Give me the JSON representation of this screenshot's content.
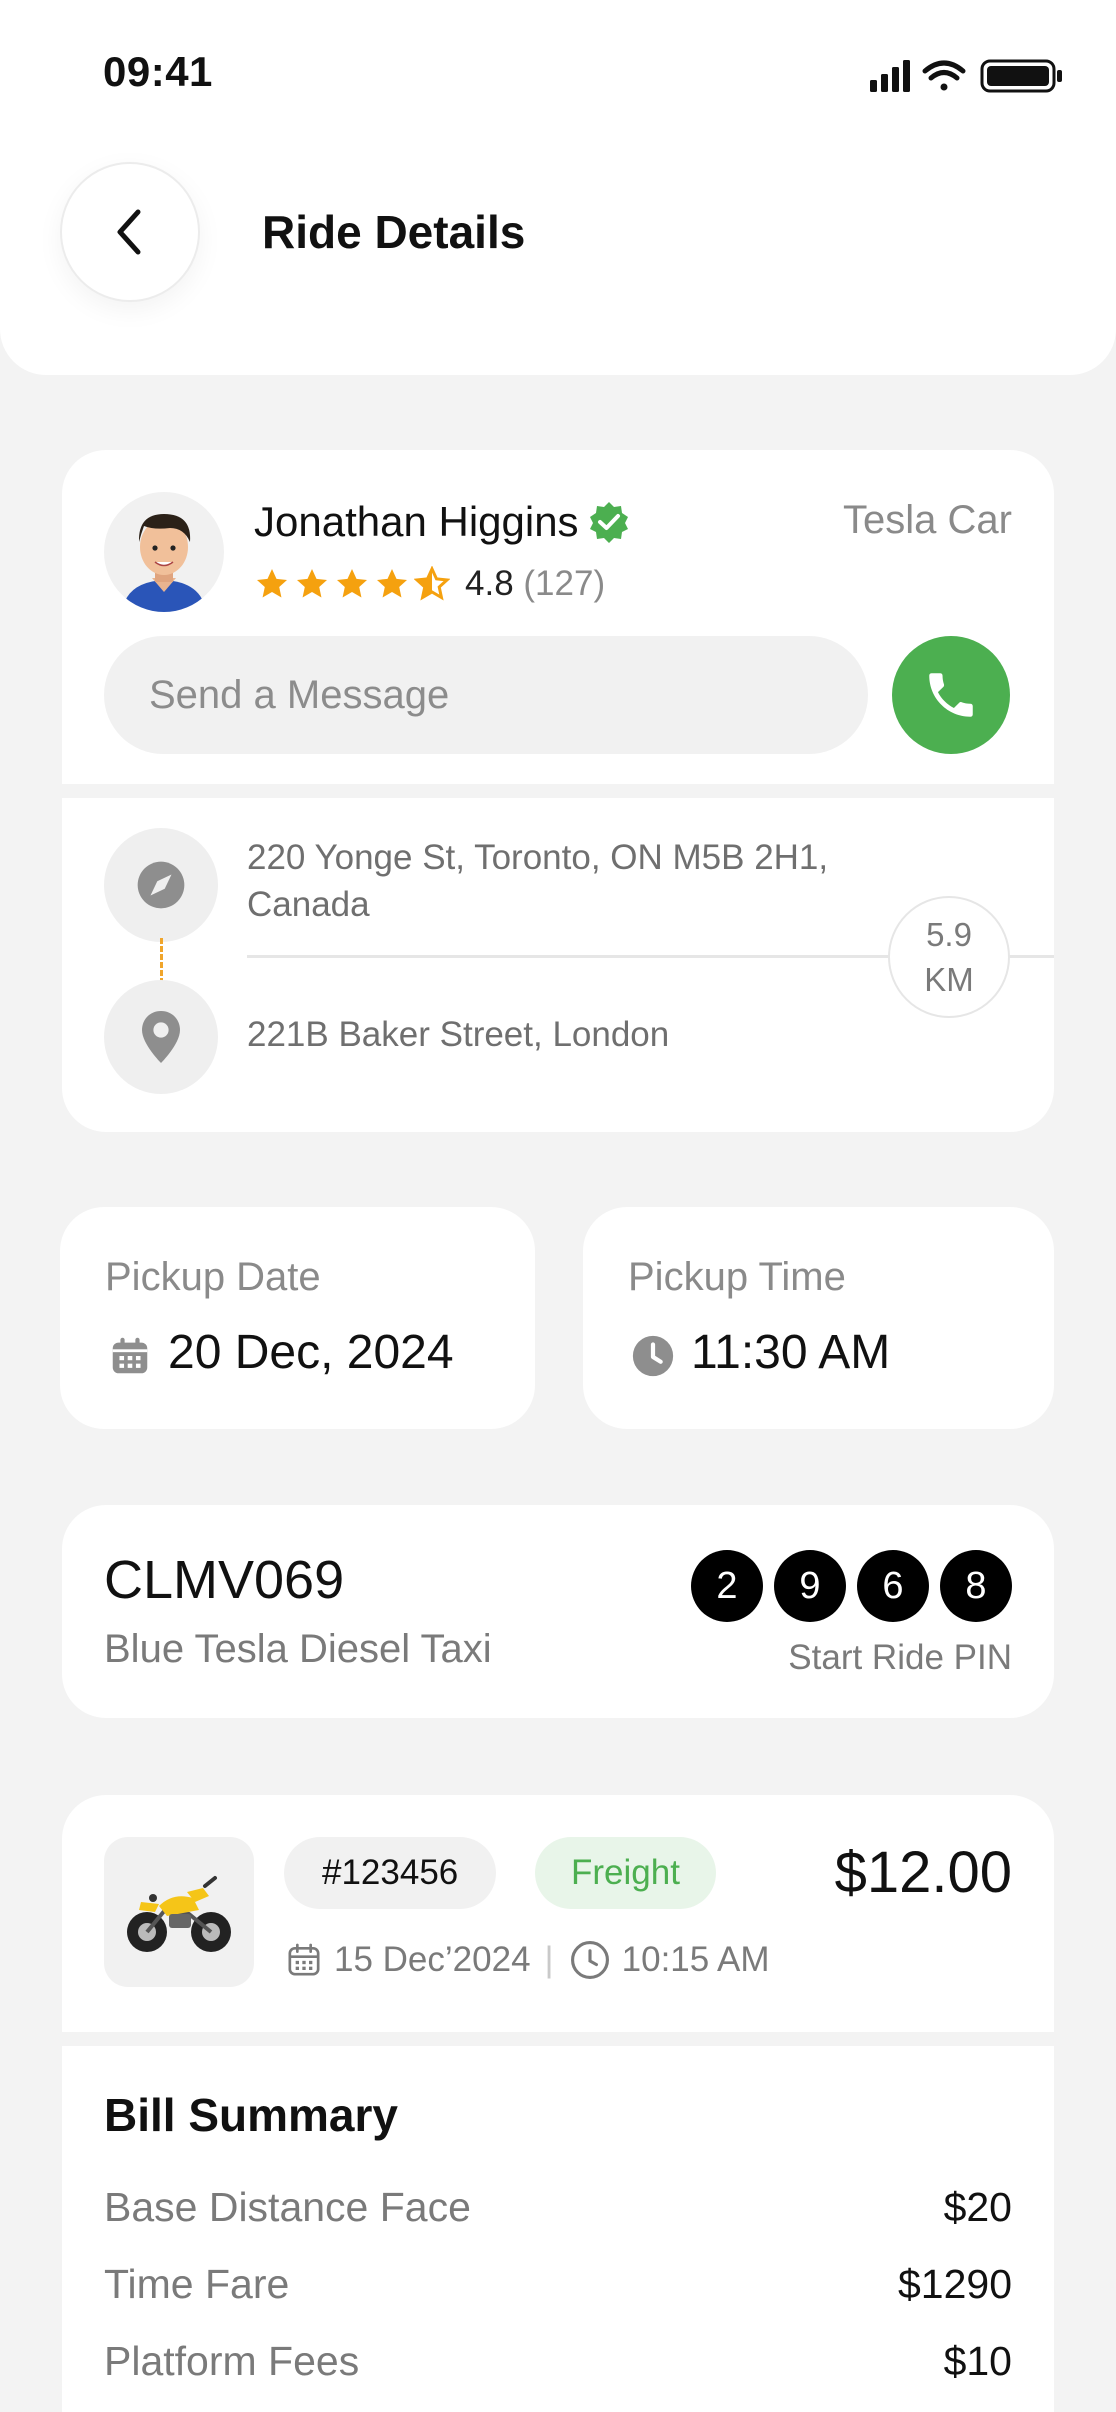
{
  "status_bar": {
    "time": "09:41"
  },
  "header": {
    "title": "Ride Details"
  },
  "driver": {
    "name": "Jonathan Higgins",
    "rating": "4.8",
    "review_count": "(127)",
    "stars": 4.5,
    "car_type": "Tesla Car",
    "message_placeholder": "Send a Message"
  },
  "route": {
    "pickup_address": "220 Yonge St, Toronto, ON M5B 2H1, Canada",
    "dropoff_address": "221B Baker Street, London",
    "distance_value": "5.9",
    "distance_unit": "KM"
  },
  "pickup": {
    "date_label": "Pickup Date",
    "date_value": "20 Dec, 2024",
    "time_label": "Pickup Time",
    "time_value": "11:30 AM"
  },
  "vehicle": {
    "plate": "CLMV069",
    "description": "Blue Tesla Diesel Taxi",
    "pin_digits": [
      "2",
      "9",
      "6",
      "8"
    ],
    "pin_label": "Start Ride PIN"
  },
  "order": {
    "id": "#123456",
    "tag": "Freight",
    "price": "$12.00",
    "date": "15 Dec’2024",
    "time": "10:15 AM"
  },
  "bill": {
    "title": "Bill Summary",
    "rows": [
      {
        "label": "Base Distance Face",
        "amount": "$20"
      },
      {
        "label": "Time Fare",
        "amount": "$1290"
      },
      {
        "label": "Platform Fees",
        "amount": "$10"
      }
    ]
  },
  "colors": {
    "accent_green": "#4caf50",
    "star_orange": "#f5a10f",
    "route_dash": "#f0a52b",
    "background": "#f3f3f3"
  }
}
